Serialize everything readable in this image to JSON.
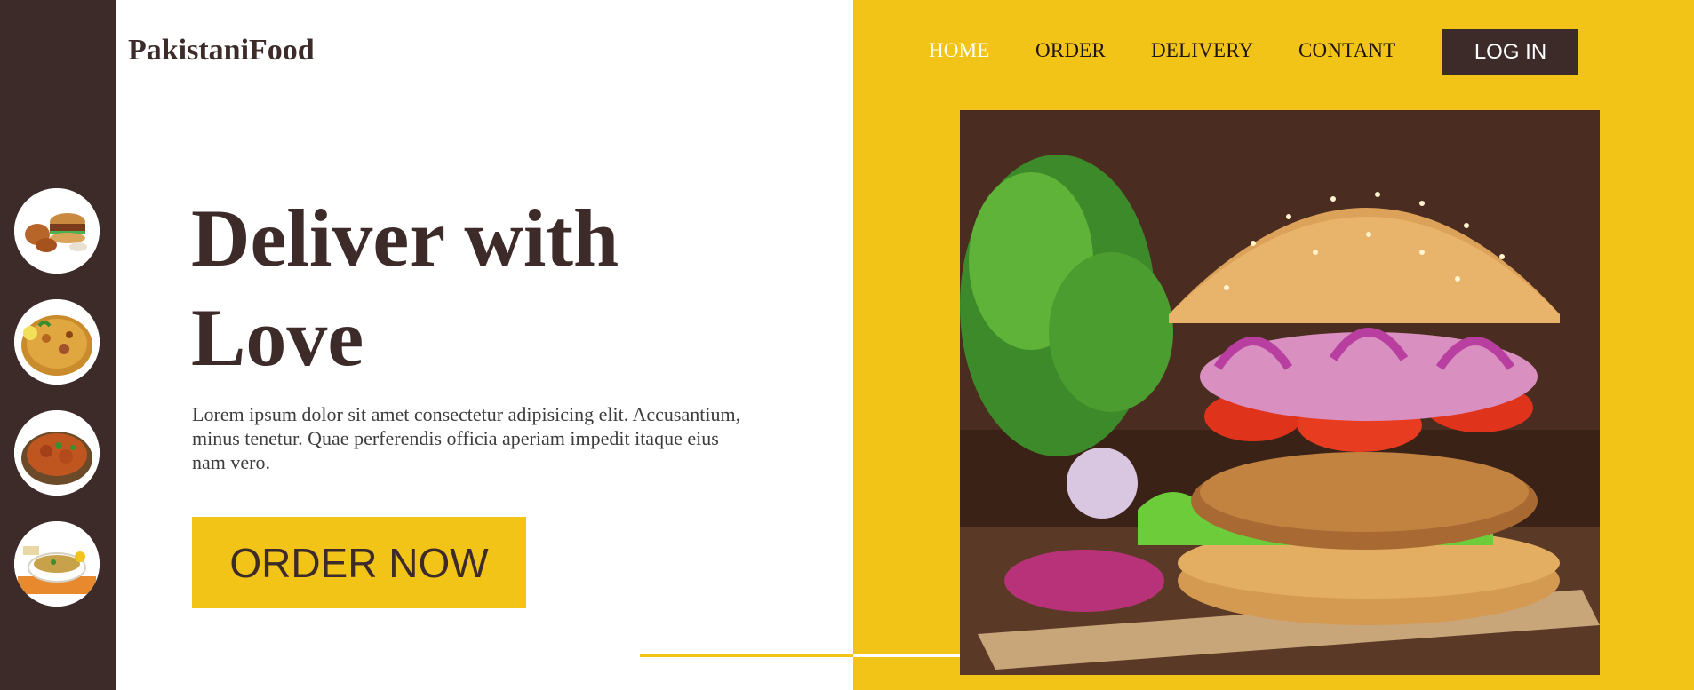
{
  "brand": {
    "name": "PakistaniFood"
  },
  "nav": {
    "items": [
      "HOME",
      "ORDER",
      "DELIVERY",
      "CONTANT"
    ],
    "active": "HOME",
    "login_label": "LOG IN"
  },
  "hero": {
    "title_line1": "Deliver with",
    "title_line2": "Love",
    "description": "Lorem ipsum dolor sit amet consectetur adipisicing elit. Accusantium, minus tenetur. Quae perferendis officia aperiam impedit itaque eius nam vero.",
    "cta_label": "ORDER NOW"
  },
  "sidebar": {
    "thumbnails": [
      "fried-chicken-burger-platter",
      "biryani",
      "chicken-karahi",
      "haleem-bowl"
    ]
  },
  "colors": {
    "brown": "#3d2b29",
    "yellow": "#f2c418",
    "white": "#ffffff"
  },
  "images": {
    "hero_photo": "burger-photo"
  }
}
